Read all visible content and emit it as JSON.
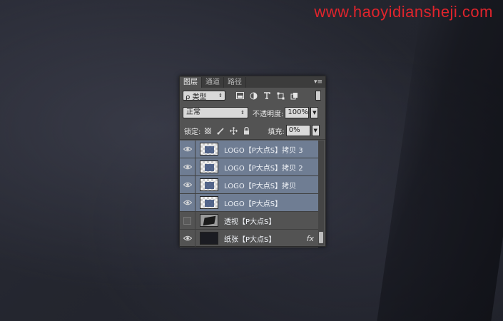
{
  "watermark": "www.haoyidiansheji.com",
  "panel": {
    "tabs": [
      {
        "label": "图层",
        "active": true
      },
      {
        "label": "通道",
        "active": false
      },
      {
        "label": "路径",
        "active": false
      }
    ],
    "filter": {
      "label": "ρ 类型"
    },
    "filter_icons": [
      "image-filter-icon",
      "adjustment-filter-icon",
      "type-filter-icon",
      "shape-filter-icon",
      "smart-object-filter-icon"
    ],
    "blend_mode": "正常",
    "opacity_label": "不透明度:",
    "opacity_value": "100%",
    "lock_label": "锁定:",
    "fill_label": "填充:",
    "fill_value": "0%",
    "layers": [
      {
        "name": "LOGO【P大点S】拷贝 3",
        "visible": true,
        "selected": true,
        "thumb": "logo"
      },
      {
        "name": "LOGO【P大点S】拷贝 2",
        "visible": true,
        "selected": true,
        "thumb": "logo"
      },
      {
        "name": "LOGO【P大点S】拷贝",
        "visible": true,
        "selected": true,
        "thumb": "logo"
      },
      {
        "name": "LOGO【P大点S】",
        "visible": true,
        "selected": true,
        "thumb": "logo"
      },
      {
        "name": "透视【P大点S】",
        "visible": false,
        "selected": false,
        "thumb": "persp"
      },
      {
        "name": "纸张【P大点S】",
        "visible": true,
        "selected": false,
        "thumb": "paper",
        "fx": "fx"
      }
    ]
  }
}
